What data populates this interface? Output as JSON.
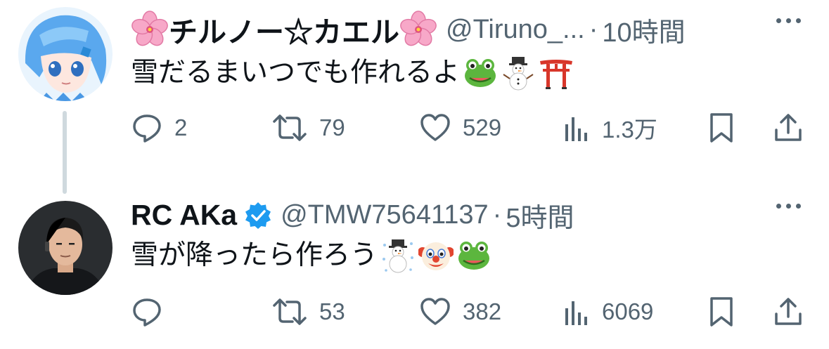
{
  "tweets": [
    {
      "display_name": "チルノー☆カエル",
      "handle": "@Tiruno_...",
      "separator": "·",
      "time": "10時間",
      "text": "雪だるまいつでも作れるよ",
      "emojis": [
        "frog-emoji",
        "snowman-emoji",
        "torii-emoji"
      ],
      "name_emojis": [
        "cherry-blossom-emoji",
        "cherry-blossom-emoji"
      ],
      "verified": false,
      "reply_count": "2",
      "retweet_count": "79",
      "like_count": "529",
      "view_count": "1.3万"
    },
    {
      "display_name": "RC AKa",
      "handle": "@TMW75641137",
      "separator": "·",
      "time": "5時間",
      "text": "雪が降ったら作ろう",
      "emojis": [
        "snowman-with-snow-emoji",
        "clown-emoji",
        "frog-emoji"
      ],
      "verified": true,
      "reply_count": "",
      "retweet_count": "53",
      "like_count": "382",
      "view_count": "6069"
    }
  ],
  "colors": {
    "text_primary": "#0f1419",
    "text_secondary": "#536471",
    "verified_blue": "#1d9bf0",
    "thread_line": "#cfd9de"
  }
}
